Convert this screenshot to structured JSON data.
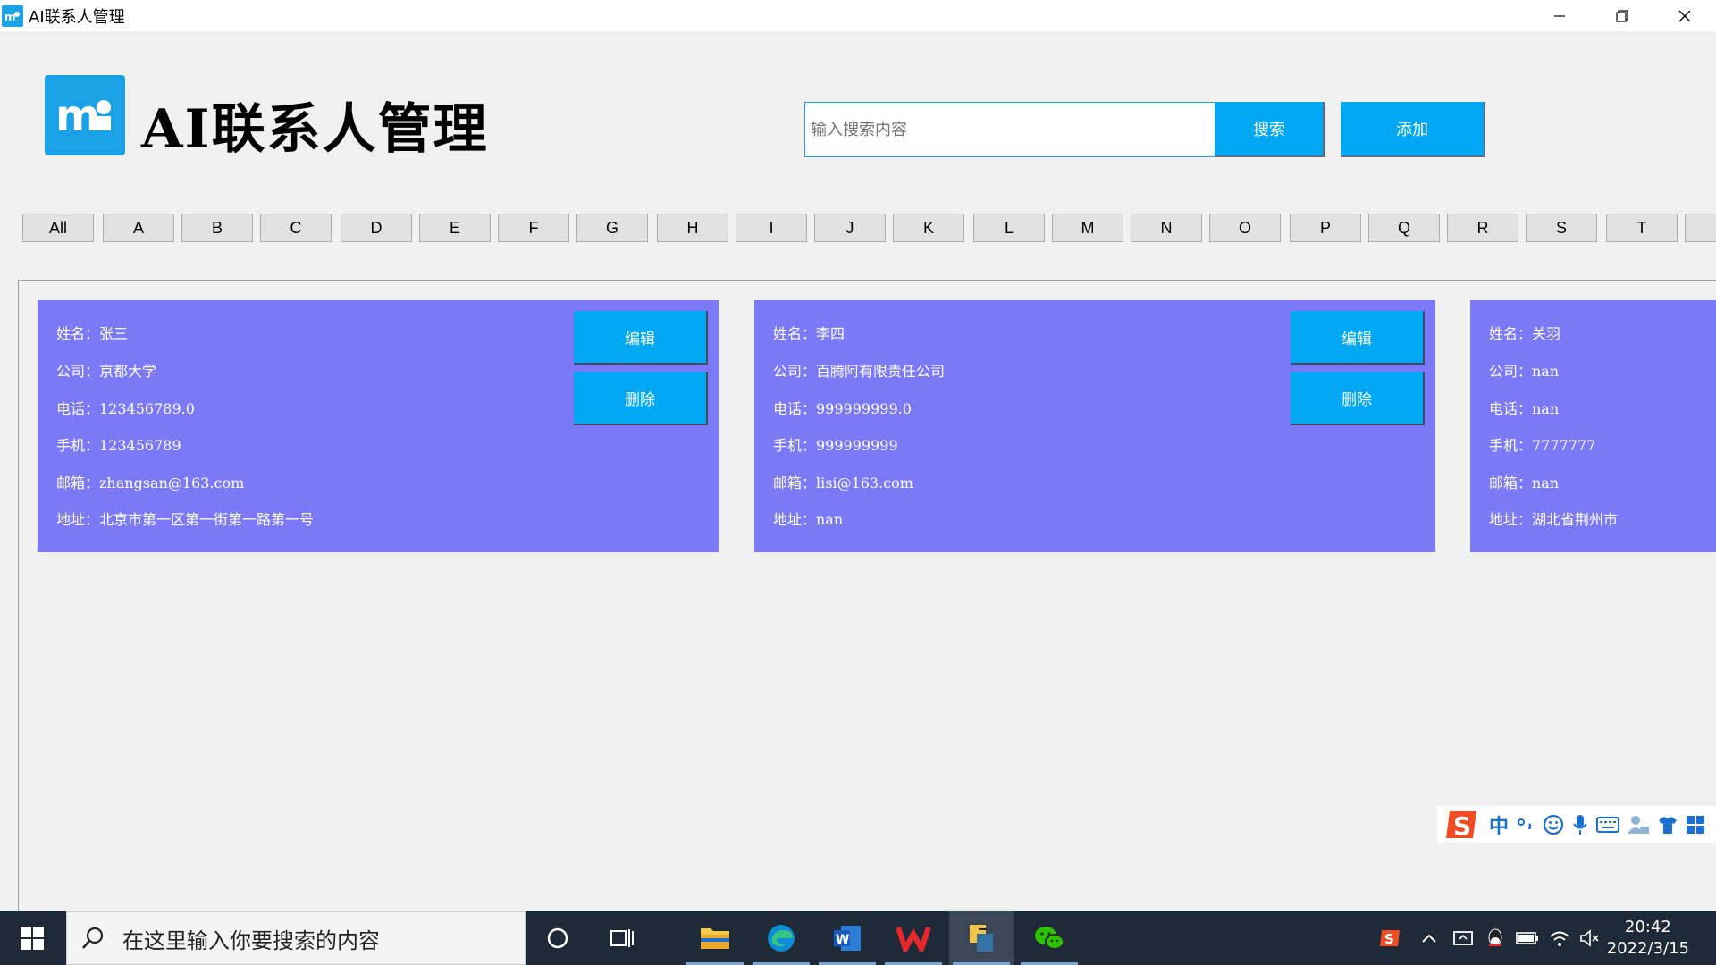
{
  "window": {
    "title": "AI联系人管理"
  },
  "header": {
    "heading": "AI联系人管理",
    "search_placeholder": "输入搜索内容",
    "search_label": "搜索",
    "add_label": "添加"
  },
  "letters": [
    "All",
    "A",
    "B",
    "C",
    "D",
    "E",
    "F",
    "G",
    "H",
    "I",
    "J",
    "K",
    "L",
    "M",
    "N",
    "O",
    "P",
    "Q",
    "R",
    "S",
    "T"
  ],
  "contacts": [
    {
      "name": "姓名：张三",
      "company": "公司：京都大学",
      "phone": "电话：123456789.0",
      "mobile": "手机：123456789",
      "email": "邮箱：zhangsan@163.com",
      "address": "地址：北京市第一区第一街第一路第一号",
      "edit_label": "编辑",
      "delete_label": "删除"
    },
    {
      "name": "姓名：李四",
      "company": "公司：百腾阿有限责任公司",
      "phone": "电话：999999999.0",
      "mobile": "手机：999999999",
      "email": "邮箱：lisi@163.com",
      "address": "地址：nan",
      "edit_label": "编辑",
      "delete_label": "删除"
    },
    {
      "name": "姓名：关羽",
      "company": "公司：nan",
      "phone": "电话：nan",
      "mobile": "手机：7777777",
      "email": "邮箱：nan",
      "address": "地址：湖北省荆州市"
    }
  ],
  "taskbar": {
    "search_placeholder": "在这里输入你要搜索的内容",
    "time": "20:42",
    "date": "2022/3/15",
    "ime_mode": "中"
  },
  "colors": {
    "accent": "#00a8f3",
    "card_bg": "#7b79f6",
    "taskbar_bg": "#1f2a38"
  }
}
